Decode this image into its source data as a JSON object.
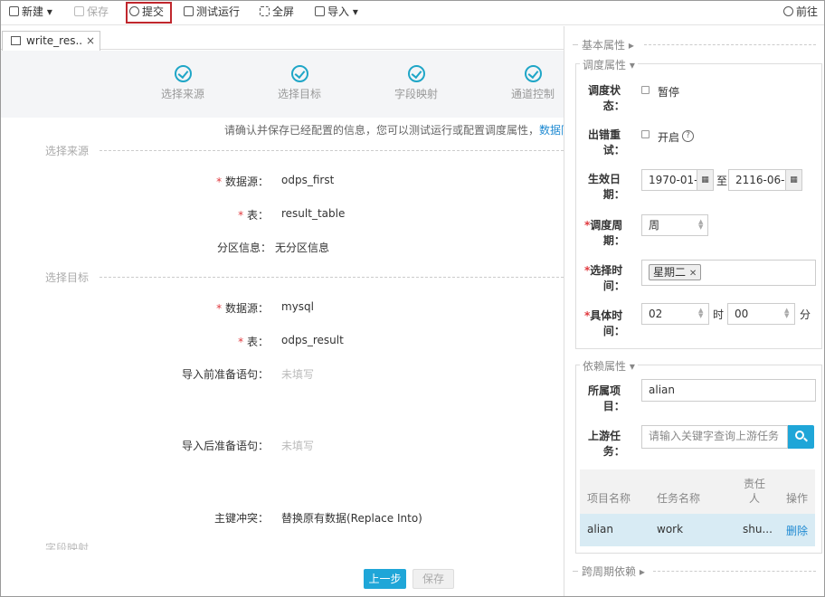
{
  "toolbar": {
    "new": "新建",
    "save": "保存",
    "submit": "提交",
    "test_run": "测试运行",
    "fullscreen": "全屏",
    "import": "导入",
    "goto": "前往"
  },
  "tab": {
    "title": "write_res.."
  },
  "steps": [
    "选择来源",
    "选择目标",
    "字段映射",
    "通道控制"
  ],
  "confirm_text": "请确认并保存已经配置的信息，您可以测试运行或配置调度属性，",
  "confirm_link": "数据同",
  "source": {
    "section": "选择来源",
    "datasource_label": "数据源：",
    "datasource": "odps_first",
    "table_label": "表：",
    "table": "result_table",
    "partition_label": "分区信息：",
    "partition": "无分区信息"
  },
  "target": {
    "section": "选择目标",
    "datasource_label": "数据源：",
    "datasource": "mysql",
    "table_label": "表：",
    "table": "odps_result",
    "pre_sql_label": "导入前准备语句：",
    "pre_sql": "未填写",
    "post_sql_label": "导入后准备语句：",
    "post_sql": "未填写",
    "conflict_label": "主键冲突：",
    "conflict": "替换原有数据(Replace Into)"
  },
  "cut_section": "字段映射",
  "buttons": {
    "prev": "上一步",
    "save": "保存"
  },
  "panel": {
    "basic": "基本属性",
    "schedule": {
      "title": "调度属性",
      "status_label": "调度状态：",
      "status_value": "暂停",
      "retry_label": "出错重试：",
      "retry_value": "开启",
      "help": "?",
      "effective_label": "生效日期：",
      "date_from": "1970-01-",
      "to": "至",
      "date_to": "2116-06-",
      "period_label": "调度周期：",
      "period": "周",
      "select_time_label": "选择时间：",
      "selected_day": "星期二",
      "time_label": "具体时间：",
      "hour": "02",
      "hour_unit": "时",
      "minute": "00",
      "minute_unit": "分"
    },
    "dependency": {
      "title": "依赖属性",
      "project_label": "所属项目：",
      "project": "alian",
      "upstream_label": "上游任务：",
      "upstream_placeholder": "请输入关键字查询上游任务",
      "columns": [
        "项目名称",
        "任务名称",
        "责任人",
        "操作"
      ],
      "row": {
        "project": "alian",
        "task": "work",
        "owner": "shu...",
        "action": "删除"
      }
    },
    "cross_cycle": "跨周期依赖"
  }
}
